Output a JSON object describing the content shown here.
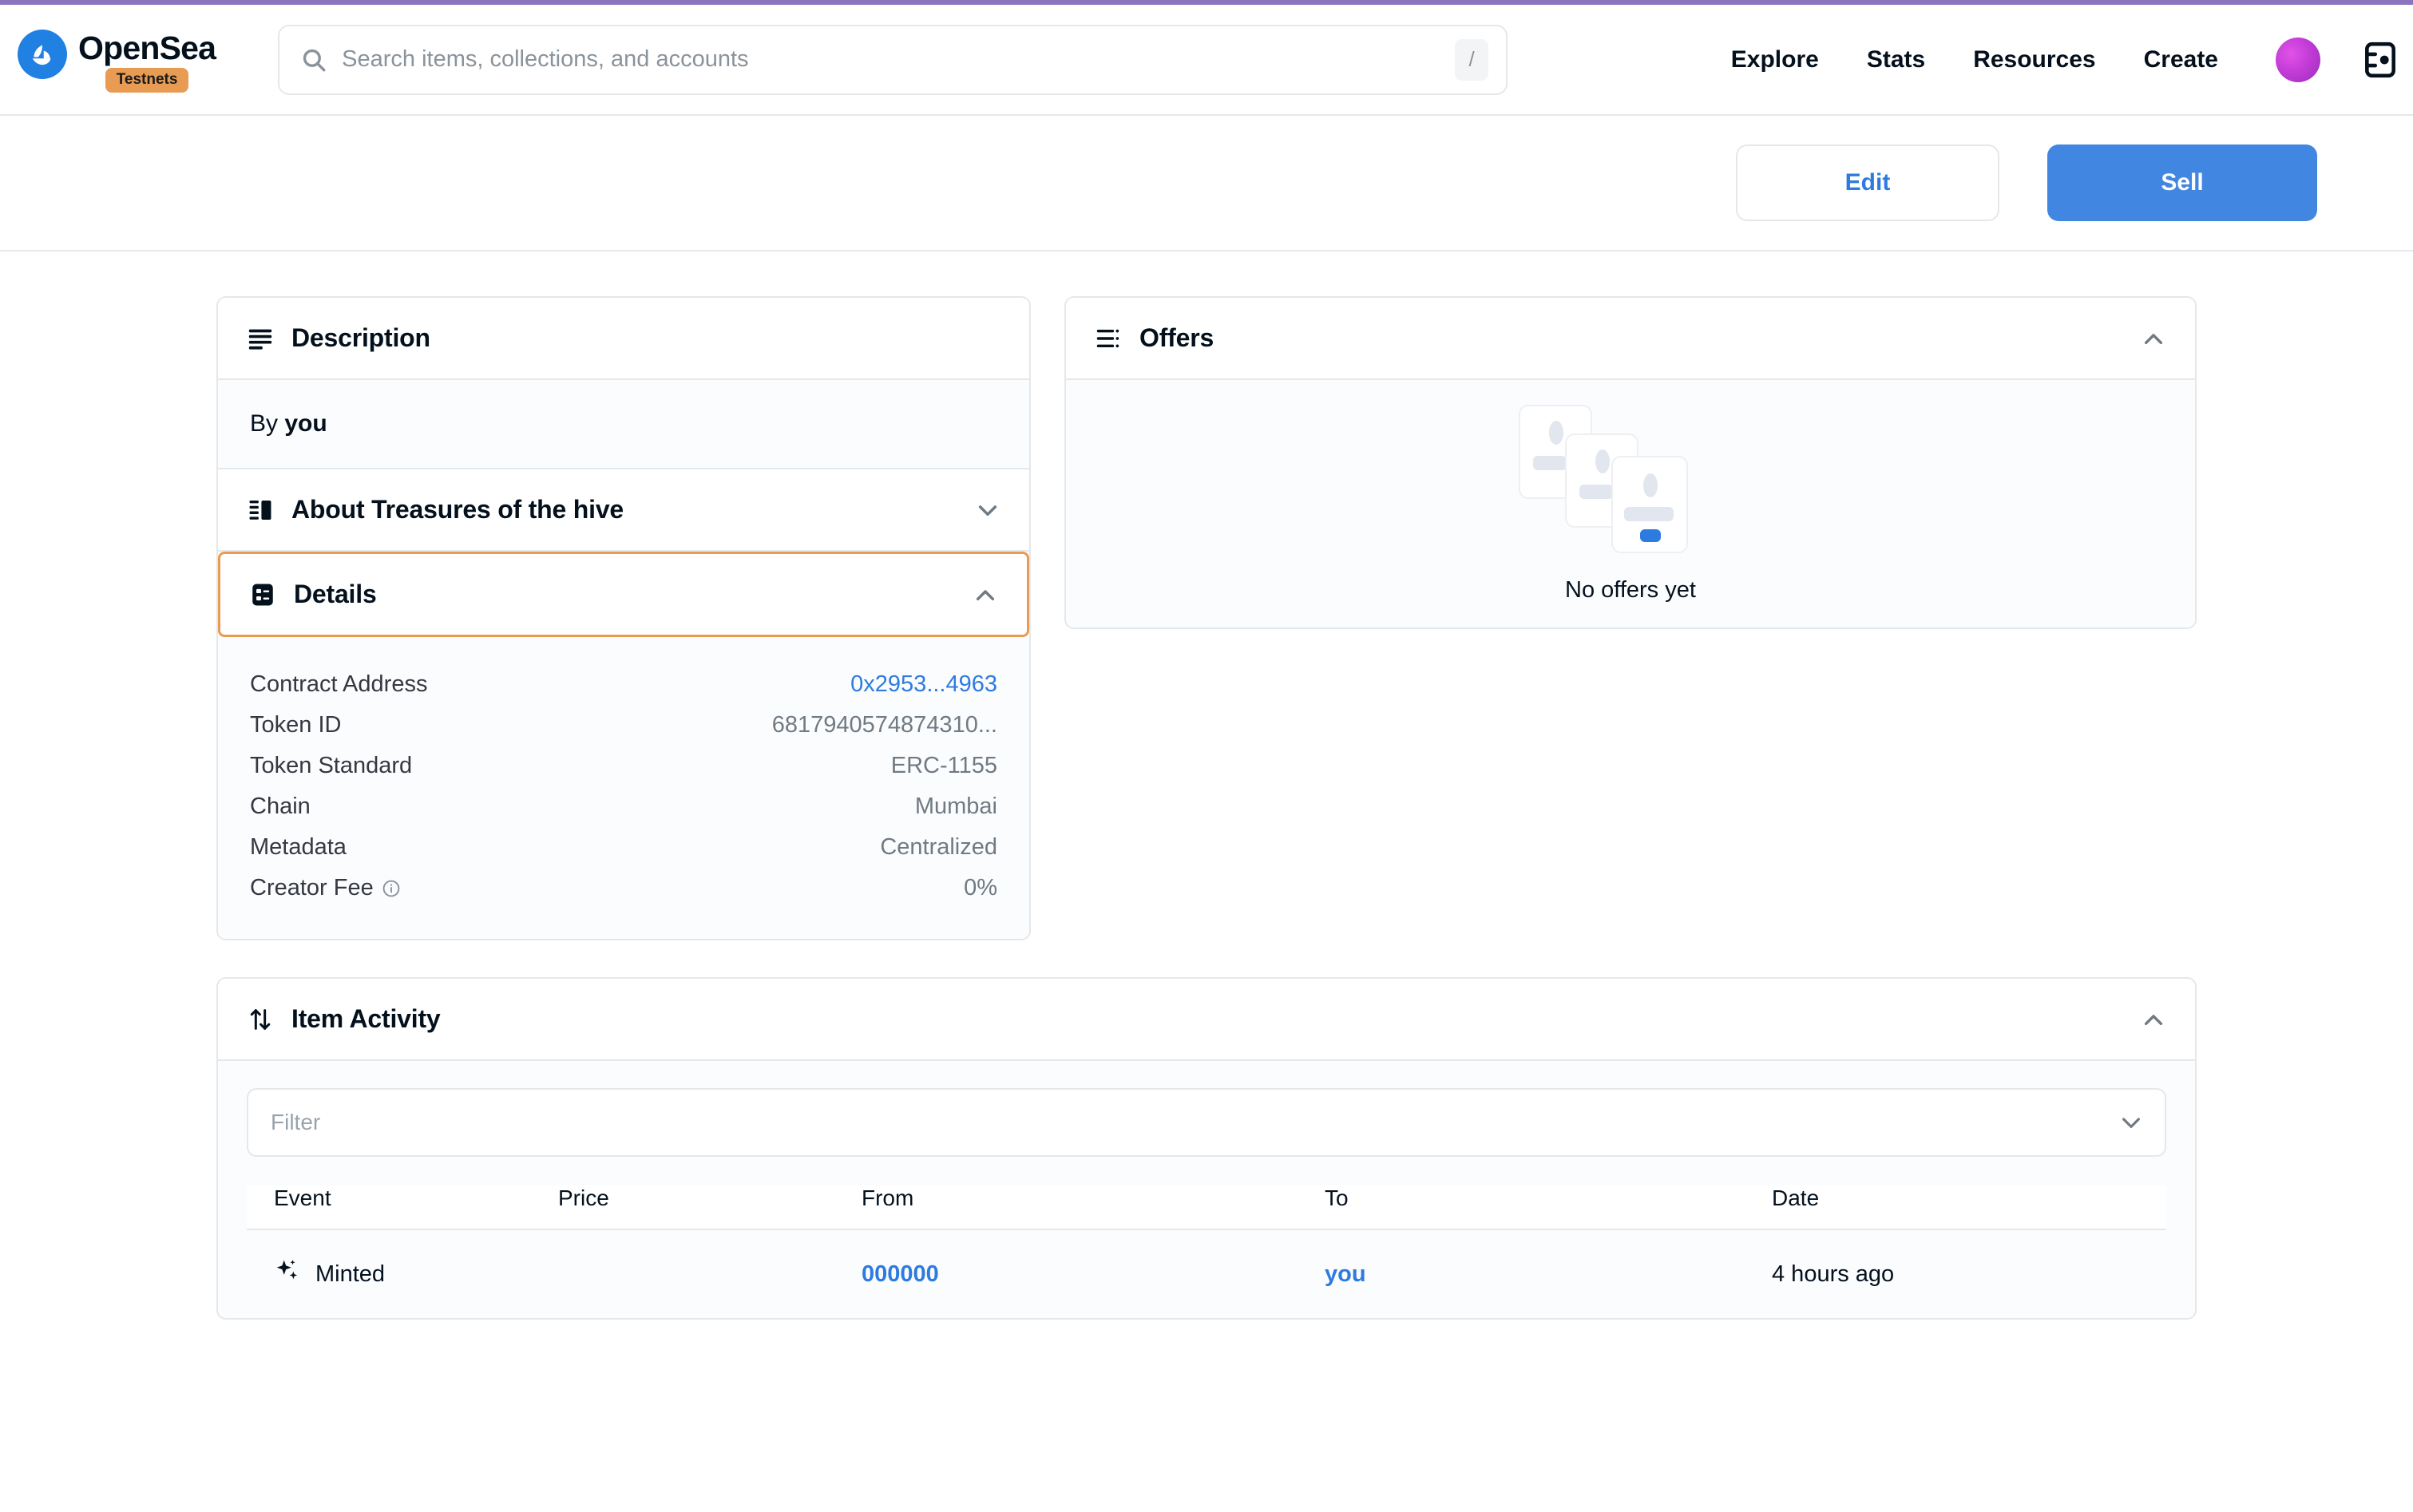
{
  "brand": {
    "name": "OpenSea",
    "badge": "Testnets",
    "logo_icon": "opensea-ship-icon",
    "logo_color": "#2081E2",
    "badge_color": "#E89B53"
  },
  "accent_bar_color": "#8A74BE",
  "search": {
    "placeholder": "Search items, collections, and accounts",
    "value": "",
    "icon": "search-icon",
    "shortcut_key": "/"
  },
  "nav": {
    "items": [
      {
        "label": "Explore"
      },
      {
        "label": "Stats"
      },
      {
        "label": "Resources"
      },
      {
        "label": "Create"
      }
    ],
    "avatar_icon": "avatar",
    "wallet_icon": "wallet-icon"
  },
  "actions": {
    "edit_label": "Edit",
    "sell_label": "Sell",
    "sell_color": "#4186E0",
    "edit_text_color": "#2E7BE0"
  },
  "description_card": {
    "title": "Description",
    "icon": "align-left-icon",
    "by_prefix": "By",
    "by_value": "you",
    "about_title": "About Treasures of the hive",
    "about_icon": "collection-icon",
    "about_chevron": "chevron-down-icon",
    "details_title": "Details",
    "details_icon": "list-details-icon",
    "details_chevron": "chevron-up-icon",
    "details_focus_color": "#E89B53",
    "details": [
      {
        "label": "Contract Address",
        "value": "0x2953...4963",
        "link": true
      },
      {
        "label": "Token ID",
        "value": "6817940574874310...",
        "link": false
      },
      {
        "label": "Token Standard",
        "value": "ERC-1155",
        "link": false
      },
      {
        "label": "Chain",
        "value": "Mumbai",
        "link": false
      },
      {
        "label": "Metadata",
        "value": "Centralized",
        "link": false
      },
      {
        "label": "Creator Fee",
        "value": "0%",
        "link": false,
        "info": true
      }
    ]
  },
  "offers_card": {
    "title": "Offers",
    "icon": "list-icon",
    "chevron": "chevron-up-icon",
    "empty_text": "No offers yet",
    "empty_icon": "stacked-cards-icon"
  },
  "activity_card": {
    "title": "Item Activity",
    "icon": "transfer-arrows-icon",
    "chevron": "chevron-up-icon",
    "filter_placeholder": "Filter",
    "filter_value": "",
    "filter_chevron": "chevron-down-icon",
    "columns": [
      "Event",
      "Price",
      "From",
      "To",
      "Date"
    ],
    "rows": [
      {
        "event": "Minted",
        "event_icon": "sparkle-icon",
        "price": "",
        "from": "000000",
        "to": "you",
        "date": "4 hours ago"
      }
    ]
  }
}
